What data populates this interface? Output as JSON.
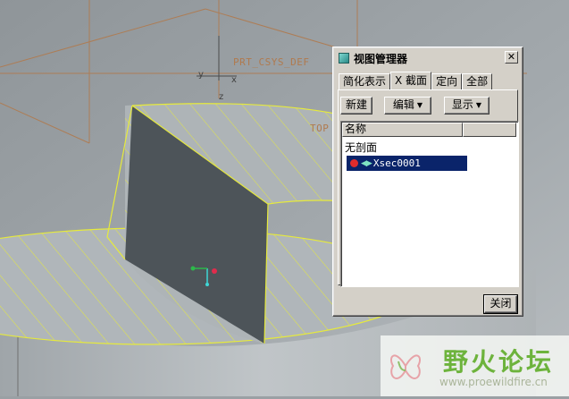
{
  "viewport": {
    "csys_label": "PRT_CSYS_DEF",
    "plane_label": "TOP",
    "axis_labels": {
      "x": "x",
      "y": "y",
      "z": "z"
    },
    "background_color": "#9aa0a4",
    "section_fill_color": "#4d5459",
    "edge_highlight_color": "#e6ea3c",
    "datum_color": "#b07a4e"
  },
  "view_manager": {
    "title": "视图管理器",
    "close_glyph": "✕",
    "tabs": [
      {
        "label": "简化表示",
        "active": false
      },
      {
        "label": "X 截面",
        "active": true
      },
      {
        "label": "定向",
        "active": false
      },
      {
        "label": "全部",
        "active": false
      }
    ],
    "toolbar": {
      "new_label": "新建",
      "edit_label": "编辑",
      "display_label": "显示",
      "dropdown_glyph": "▼"
    },
    "list": {
      "column_name": "名称",
      "items": [
        {
          "label": "无剖面",
          "selected": false
        },
        {
          "label": "Xsec0001",
          "selected": true,
          "icons": [
            "active-dot-icon",
            "visible-eye-icon"
          ]
        }
      ]
    },
    "close_button_label": "关闭",
    "selection_color": "#0a246a"
  },
  "watermark": {
    "brand": "野火论坛",
    "url": "www.proewildfire.cn"
  }
}
